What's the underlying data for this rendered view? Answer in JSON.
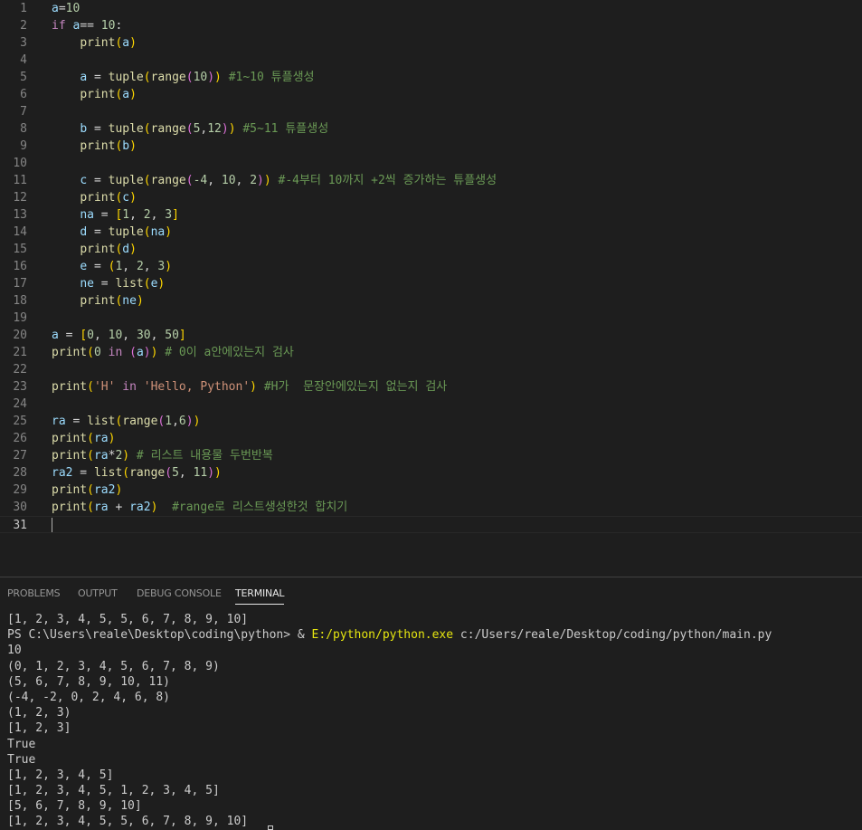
{
  "editor": {
    "current_line": 31,
    "lines": [
      {
        "n": "1",
        "tokens": [
          {
            "t": "a",
            "c": "v"
          },
          {
            "t": "=",
            "c": "p"
          },
          {
            "t": "10",
            "c": "n"
          }
        ]
      },
      {
        "n": "2",
        "tokens": [
          {
            "t": "if ",
            "c": "k"
          },
          {
            "t": "a",
            "c": "v"
          },
          {
            "t": "== ",
            "c": "p"
          },
          {
            "t": "10",
            "c": "n"
          },
          {
            "t": ":",
            "c": "p"
          }
        ]
      },
      {
        "n": "3",
        "tokens": [
          {
            "t": "    ",
            "c": "p"
          },
          {
            "t": "print",
            "c": "f"
          },
          {
            "t": "(",
            "c": "b"
          },
          {
            "t": "a",
            "c": "v"
          },
          {
            "t": ")",
            "c": "b"
          }
        ]
      },
      {
        "n": "4",
        "tokens": []
      },
      {
        "n": "5",
        "tokens": [
          {
            "t": "    ",
            "c": "p"
          },
          {
            "t": "a",
            "c": "v"
          },
          {
            "t": " = ",
            "c": "p"
          },
          {
            "t": "tuple",
            "c": "f"
          },
          {
            "t": "(",
            "c": "b"
          },
          {
            "t": "range",
            "c": "f"
          },
          {
            "t": "(",
            "c": "b2"
          },
          {
            "t": "10",
            "c": "n"
          },
          {
            "t": ")",
            "c": "b2"
          },
          {
            "t": ")",
            "c": "b"
          },
          {
            "t": " #1~10 튜플생성",
            "c": "c"
          }
        ]
      },
      {
        "n": "6",
        "tokens": [
          {
            "t": "    ",
            "c": "p"
          },
          {
            "t": "print",
            "c": "f"
          },
          {
            "t": "(",
            "c": "b"
          },
          {
            "t": "a",
            "c": "v"
          },
          {
            "t": ")",
            "c": "b"
          }
        ]
      },
      {
        "n": "7",
        "tokens": []
      },
      {
        "n": "8",
        "tokens": [
          {
            "t": "    ",
            "c": "p"
          },
          {
            "t": "b",
            "c": "v"
          },
          {
            "t": " = ",
            "c": "p"
          },
          {
            "t": "tuple",
            "c": "f"
          },
          {
            "t": "(",
            "c": "b"
          },
          {
            "t": "range",
            "c": "f"
          },
          {
            "t": "(",
            "c": "b2"
          },
          {
            "t": "5",
            "c": "n"
          },
          {
            "t": ",",
            "c": "p"
          },
          {
            "t": "12",
            "c": "n"
          },
          {
            "t": ")",
            "c": "b2"
          },
          {
            "t": ")",
            "c": "b"
          },
          {
            "t": " #5~11 튜플생성",
            "c": "c"
          }
        ]
      },
      {
        "n": "9",
        "tokens": [
          {
            "t": "    ",
            "c": "p"
          },
          {
            "t": "print",
            "c": "f"
          },
          {
            "t": "(",
            "c": "b"
          },
          {
            "t": "b",
            "c": "v"
          },
          {
            "t": ")",
            "c": "b"
          }
        ]
      },
      {
        "n": "10",
        "tokens": []
      },
      {
        "n": "11",
        "tokens": [
          {
            "t": "    ",
            "c": "p"
          },
          {
            "t": "c",
            "c": "v"
          },
          {
            "t": " = ",
            "c": "p"
          },
          {
            "t": "tuple",
            "c": "f"
          },
          {
            "t": "(",
            "c": "b"
          },
          {
            "t": "range",
            "c": "f"
          },
          {
            "t": "(",
            "c": "b2"
          },
          {
            "t": "-4",
            "c": "n"
          },
          {
            "t": ", ",
            "c": "p"
          },
          {
            "t": "10",
            "c": "n"
          },
          {
            "t": ", ",
            "c": "p"
          },
          {
            "t": "2",
            "c": "n"
          },
          {
            "t": ")",
            "c": "b2"
          },
          {
            "t": ")",
            "c": "b"
          },
          {
            "t": " #-4부터 10까지 +2씩 증가하는 튜플생성",
            "c": "c"
          }
        ]
      },
      {
        "n": "12",
        "tokens": [
          {
            "t": "    ",
            "c": "p"
          },
          {
            "t": "print",
            "c": "f"
          },
          {
            "t": "(",
            "c": "b"
          },
          {
            "t": "c",
            "c": "v"
          },
          {
            "t": ")",
            "c": "b"
          }
        ]
      },
      {
        "n": "13",
        "tokens": [
          {
            "t": "    ",
            "c": "p"
          },
          {
            "t": "na",
            "c": "v"
          },
          {
            "t": " = ",
            "c": "p"
          },
          {
            "t": "[",
            "c": "b"
          },
          {
            "t": "1",
            "c": "n"
          },
          {
            "t": ", ",
            "c": "p"
          },
          {
            "t": "2",
            "c": "n"
          },
          {
            "t": ", ",
            "c": "p"
          },
          {
            "t": "3",
            "c": "n"
          },
          {
            "t": "]",
            "c": "b"
          }
        ]
      },
      {
        "n": "14",
        "tokens": [
          {
            "t": "    ",
            "c": "p"
          },
          {
            "t": "d",
            "c": "v"
          },
          {
            "t": " = ",
            "c": "p"
          },
          {
            "t": "tuple",
            "c": "f"
          },
          {
            "t": "(",
            "c": "b"
          },
          {
            "t": "na",
            "c": "v"
          },
          {
            "t": ")",
            "c": "b"
          }
        ]
      },
      {
        "n": "15",
        "tokens": [
          {
            "t": "    ",
            "c": "p"
          },
          {
            "t": "print",
            "c": "f"
          },
          {
            "t": "(",
            "c": "b"
          },
          {
            "t": "d",
            "c": "v"
          },
          {
            "t": ")",
            "c": "b"
          }
        ]
      },
      {
        "n": "16",
        "tokens": [
          {
            "t": "    ",
            "c": "p"
          },
          {
            "t": "e",
            "c": "v"
          },
          {
            "t": " = ",
            "c": "p"
          },
          {
            "t": "(",
            "c": "b"
          },
          {
            "t": "1",
            "c": "n"
          },
          {
            "t": ", ",
            "c": "p"
          },
          {
            "t": "2",
            "c": "n"
          },
          {
            "t": ", ",
            "c": "p"
          },
          {
            "t": "3",
            "c": "n"
          },
          {
            "t": ")",
            "c": "b"
          }
        ]
      },
      {
        "n": "17",
        "tokens": [
          {
            "t": "    ",
            "c": "p"
          },
          {
            "t": "ne",
            "c": "v"
          },
          {
            "t": " = ",
            "c": "p"
          },
          {
            "t": "list",
            "c": "f"
          },
          {
            "t": "(",
            "c": "b"
          },
          {
            "t": "e",
            "c": "v"
          },
          {
            "t": ")",
            "c": "b"
          }
        ]
      },
      {
        "n": "18",
        "tokens": [
          {
            "t": "    ",
            "c": "p"
          },
          {
            "t": "print",
            "c": "f"
          },
          {
            "t": "(",
            "c": "b"
          },
          {
            "t": "ne",
            "c": "v"
          },
          {
            "t": ")",
            "c": "b"
          }
        ]
      },
      {
        "n": "19",
        "tokens": []
      },
      {
        "n": "20",
        "tokens": [
          {
            "t": "a",
            "c": "v"
          },
          {
            "t": " = ",
            "c": "p"
          },
          {
            "t": "[",
            "c": "b"
          },
          {
            "t": "0",
            "c": "n"
          },
          {
            "t": ", ",
            "c": "p"
          },
          {
            "t": "10",
            "c": "n"
          },
          {
            "t": ", ",
            "c": "p"
          },
          {
            "t": "30",
            "c": "n"
          },
          {
            "t": ", ",
            "c": "p"
          },
          {
            "t": "50",
            "c": "n"
          },
          {
            "t": "]",
            "c": "b"
          }
        ]
      },
      {
        "n": "21",
        "tokens": [
          {
            "t": "print",
            "c": "f"
          },
          {
            "t": "(",
            "c": "b"
          },
          {
            "t": "0",
            "c": "n"
          },
          {
            "t": " in ",
            "c": "k"
          },
          {
            "t": "(",
            "c": "b2"
          },
          {
            "t": "a",
            "c": "v"
          },
          {
            "t": ")",
            "c": "b2"
          },
          {
            "t": ")",
            "c": "b"
          },
          {
            "t": " # 0이 a안에있는지 검사",
            "c": "c"
          }
        ]
      },
      {
        "n": "22",
        "tokens": []
      },
      {
        "n": "23",
        "tokens": [
          {
            "t": "print",
            "c": "f"
          },
          {
            "t": "(",
            "c": "b"
          },
          {
            "t": "'H'",
            "c": "s"
          },
          {
            "t": " in ",
            "c": "k"
          },
          {
            "t": "'Hello, Python'",
            "c": "s"
          },
          {
            "t": ")",
            "c": "b"
          },
          {
            "t": " #H가  문장안에있는지 없는지 검사",
            "c": "c"
          }
        ]
      },
      {
        "n": "24",
        "tokens": []
      },
      {
        "n": "25",
        "tokens": [
          {
            "t": "ra",
            "c": "v"
          },
          {
            "t": " = ",
            "c": "p"
          },
          {
            "t": "list",
            "c": "f"
          },
          {
            "t": "(",
            "c": "b"
          },
          {
            "t": "range",
            "c": "f"
          },
          {
            "t": "(",
            "c": "b2"
          },
          {
            "t": "1",
            "c": "n"
          },
          {
            "t": ",",
            "c": "p"
          },
          {
            "t": "6",
            "c": "n"
          },
          {
            "t": ")",
            "c": "b2"
          },
          {
            "t": ")",
            "c": "b"
          }
        ]
      },
      {
        "n": "26",
        "tokens": [
          {
            "t": "print",
            "c": "f"
          },
          {
            "t": "(",
            "c": "b"
          },
          {
            "t": "ra",
            "c": "v"
          },
          {
            "t": ")",
            "c": "b"
          }
        ]
      },
      {
        "n": "27",
        "tokens": [
          {
            "t": "print",
            "c": "f"
          },
          {
            "t": "(",
            "c": "b"
          },
          {
            "t": "ra",
            "c": "v"
          },
          {
            "t": "*",
            "c": "p"
          },
          {
            "t": "2",
            "c": "n"
          },
          {
            "t": ")",
            "c": "b"
          },
          {
            "t": " # 리스트 내용물 두번반복",
            "c": "c"
          }
        ]
      },
      {
        "n": "28",
        "tokens": [
          {
            "t": "ra2",
            "c": "v"
          },
          {
            "t": " = ",
            "c": "p"
          },
          {
            "t": "list",
            "c": "f"
          },
          {
            "t": "(",
            "c": "b"
          },
          {
            "t": "range",
            "c": "f"
          },
          {
            "t": "(",
            "c": "b2"
          },
          {
            "t": "5",
            "c": "n"
          },
          {
            "t": ", ",
            "c": "p"
          },
          {
            "t": "11",
            "c": "n"
          },
          {
            "t": ")",
            "c": "b2"
          },
          {
            "t": ")",
            "c": "b"
          }
        ]
      },
      {
        "n": "29",
        "tokens": [
          {
            "t": "print",
            "c": "f"
          },
          {
            "t": "(",
            "c": "b"
          },
          {
            "t": "ra2",
            "c": "v"
          },
          {
            "t": ")",
            "c": "b"
          }
        ]
      },
      {
        "n": "30",
        "tokens": [
          {
            "t": "print",
            "c": "f"
          },
          {
            "t": "(",
            "c": "b"
          },
          {
            "t": "ra",
            "c": "v"
          },
          {
            "t": " + ",
            "c": "p"
          },
          {
            "t": "ra2",
            "c": "v"
          },
          {
            "t": ")",
            "c": "b"
          },
          {
            "t": "  #range로 리스트생성한것 합치기",
            "c": "c"
          }
        ]
      },
      {
        "n": "31",
        "tokens": []
      }
    ]
  },
  "panel": {
    "tabs": [
      {
        "label": "PROBLEMS",
        "name": "tab-problems",
        "active": false
      },
      {
        "label": "OUTPUT",
        "name": "tab-output",
        "active": false
      },
      {
        "label": "DEBUG CONSOLE",
        "name": "tab-debug-console",
        "active": false
      },
      {
        "label": "TERMINAL",
        "name": "tab-terminal",
        "active": true
      }
    ]
  },
  "terminal": {
    "line0": "[1, 2, 3, 4, 5, 5, 6, 7, 8, 9, 10]",
    "prompt": "PS C:\\Users\\reale\\Desktop\\coding\\python> & ",
    "exe": "E:/python/python.exe",
    "script": " c:/Users/reale/Desktop/coding/python/main.py",
    "output": [
      "10",
      "(0, 1, 2, 3, 4, 5, 6, 7, 8, 9)",
      "(5, 6, 7, 8, 9, 10, 11)",
      "(-4, -2, 0, 2, 4, 6, 8)",
      "(1, 2, 3)",
      "[1, 2, 3]",
      "True",
      "True",
      "[1, 2, 3, 4, 5]",
      "[1, 2, 3, 4, 5, 1, 2, 3, 4, 5]",
      "[5, 6, 7, 8, 9, 10]",
      "[1, 2, 3, 4, 5, 5, 6, 7, 8, 9, 10]"
    ]
  }
}
